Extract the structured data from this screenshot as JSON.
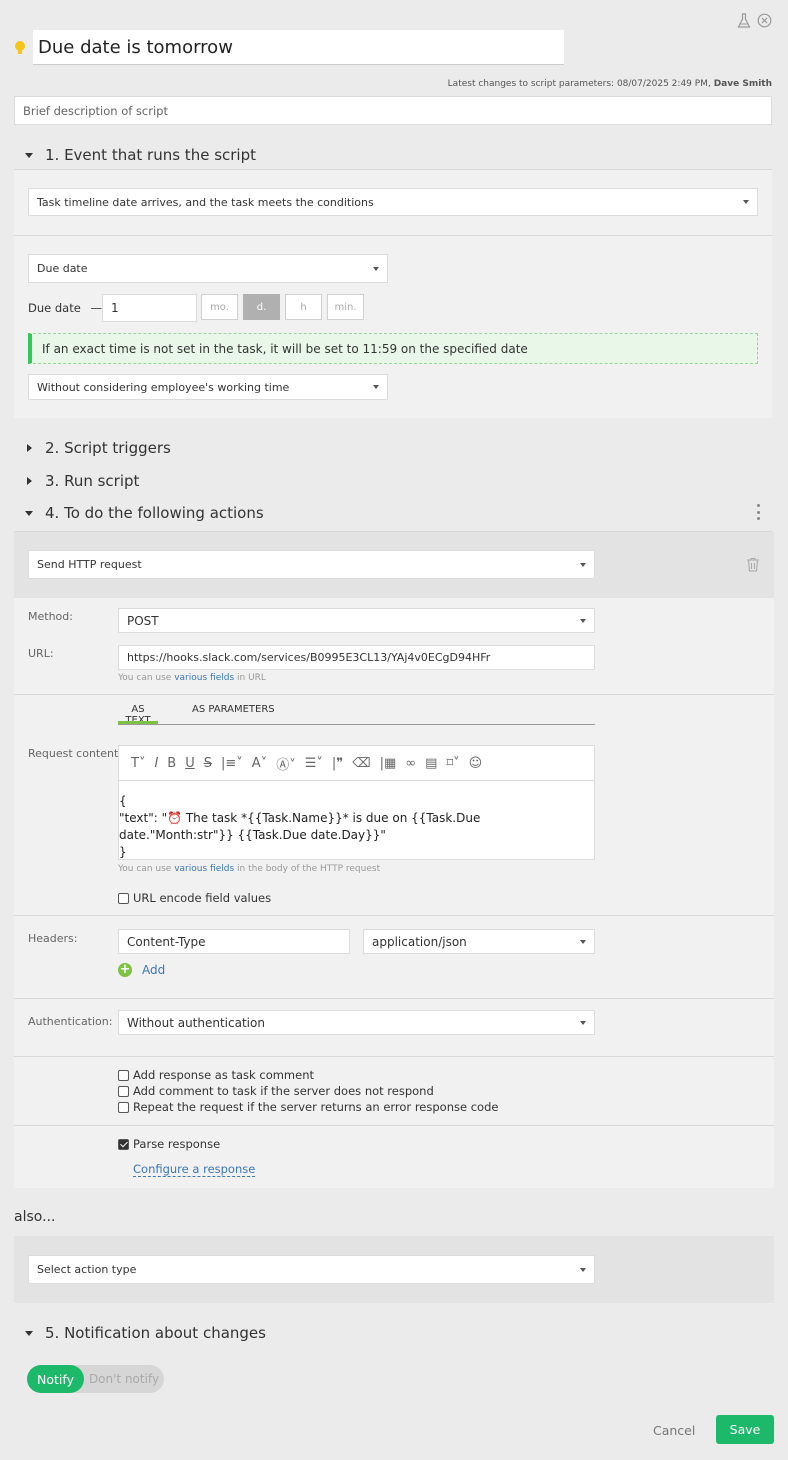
{
  "header": {
    "title": "Due date is tomorrow",
    "latest_changes_prefix": "Latest changes to script parameters: 08/07/2025 2:49 PM,",
    "latest_changes_author": "Dave Smith",
    "description_placeholder": "Brief description of script"
  },
  "section1": {
    "title": "1. Event that runs the script",
    "event_value": "Task timeline date arrives, and the task meets the conditions",
    "date_field_value": "Due date",
    "offset_label": "Due date",
    "offset_dash": "—",
    "offset_value": "1",
    "units": [
      "mo.",
      "d.",
      "h",
      "min."
    ],
    "active_unit": "d.",
    "info_text": "If an exact time is not set in the task, it will be set to 11:59 on the specified date",
    "working_time_value": "Without considering employee's working time"
  },
  "section2": {
    "title": "2. Script triggers"
  },
  "section3": {
    "title": "3. Run script"
  },
  "section4": {
    "title": "4. To do the following actions",
    "action_value": "Send HTTP request",
    "method_label": "Method:",
    "method_value": "POST",
    "url_label": "URL:",
    "url_value": "https://hooks.slack.com/services/B0995E3CL13/YAj4v0ECgD94HFr",
    "url_hint_prefix": "You can use",
    "url_hint_link": "various fields",
    "url_hint_suffix": "in URL",
    "tab_text": "AS TEXT",
    "tab_params": "AS PARAMETERS",
    "request_content_label": "Request content:",
    "body_line1": "{",
    "body_line2": "\"text\": \"⏰ The task *{{Task.Name}}* is due on {{Task.Due date.\"Month:str\"}} {{Task.Due date.Day}}\"",
    "body_line3": "}",
    "body_hint_prefix": "You can use",
    "body_hint_link": "various fields",
    "body_hint_suffix": "in the body of the HTTP request",
    "url_encode_label": "URL encode field values",
    "headers_label": "Headers:",
    "header_name": "Content-Type",
    "header_value": "application/json",
    "add_label": "Add",
    "auth_label": "Authentication:",
    "auth_value": "Without authentication",
    "cb_add_response": "Add response as task comment",
    "cb_add_comment": "Add comment to task if the server does not respond",
    "cb_repeat": "Repeat the request if the server returns an error response code",
    "cb_parse": "Parse response",
    "configure_link": "Configure a response"
  },
  "also": {
    "label": "also...",
    "select_placeholder": "Select action type"
  },
  "section5": {
    "title": "5. Notification about changes",
    "notify_on": "Notify",
    "notify_off": "Don't notify"
  },
  "footer": {
    "cancel": "Cancel",
    "save": "Save"
  },
  "colors": {
    "accent_green": "#1db96a",
    "info_bg": "#e8f7e8",
    "link_blue": "#3a78b8",
    "tab_underline": "#7dc242"
  }
}
